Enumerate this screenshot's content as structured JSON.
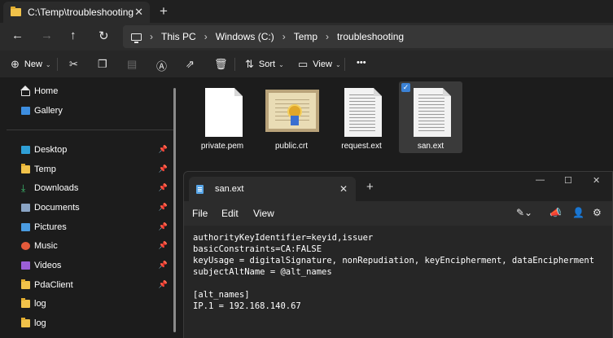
{
  "explorer": {
    "tab_title": "C:\\Temp\\troubleshooting",
    "tab_close": "✕",
    "new_tab": "+",
    "nav": {
      "back": "←",
      "forward": "→",
      "up": "↑",
      "refresh": "↻"
    },
    "breadcrumb": [
      "This PC",
      "Windows (C:)",
      "Temp",
      "troubleshooting"
    ],
    "breadcrumb_sep": "›",
    "commands": {
      "new": "New",
      "sort": "Sort",
      "view": "View",
      "more": "•••"
    },
    "sidebar": {
      "top_items": [
        {
          "label": "Home",
          "icon": "home-icon"
        },
        {
          "label": "Gallery",
          "icon": "gallery-icon"
        }
      ],
      "items": [
        {
          "label": "Desktop",
          "icon": "desktop-icon",
          "pinned": true
        },
        {
          "label": "Temp",
          "icon": "folder-icon",
          "pinned": true
        },
        {
          "label": "Downloads",
          "icon": "downloads-icon",
          "pinned": true
        },
        {
          "label": "Documents",
          "icon": "documents-icon",
          "pinned": true
        },
        {
          "label": "Pictures",
          "icon": "pictures-icon",
          "pinned": true
        },
        {
          "label": "Music",
          "icon": "music-icon",
          "pinned": true
        },
        {
          "label": "Videos",
          "icon": "videos-icon",
          "pinned": true
        },
        {
          "label": "PdaClient",
          "icon": "folder-icon",
          "pinned": true
        },
        {
          "label": "log",
          "icon": "folder-icon",
          "pinned": false
        },
        {
          "label": "log",
          "icon": "folder-icon",
          "pinned": false
        }
      ]
    },
    "files": [
      {
        "name": "private.pem",
        "icon": "blank-file-icon",
        "selected": false
      },
      {
        "name": "public.crt",
        "icon": "certificate-icon",
        "selected": false
      },
      {
        "name": "request.ext",
        "icon": "text-file-icon",
        "selected": false
      },
      {
        "name": "san.ext",
        "icon": "text-file-icon",
        "selected": true
      }
    ]
  },
  "notepad": {
    "tab_title": "san.ext",
    "tab_close": "✕",
    "new_tab": "+",
    "window_controls": {
      "minimize": "—",
      "maximize": "☐",
      "close": "✕"
    },
    "menu": {
      "file": "File",
      "edit": "Edit",
      "view": "View"
    },
    "content_lines": [
      "authorityKeyIdentifier=keyid,issuer",
      "basicConstraints=CA:FALSE",
      "keyUsage = digitalSignature, nonRepudiation, keyEncipherment, dataEncipherment",
      "subjectAltName = @alt_names",
      "",
      "[alt_names]",
      "IP.1 = 192.168.140.67"
    ]
  },
  "colors": {
    "background": "#1c1c1c",
    "accent": "#3b82d6",
    "folder": "#f1c24a"
  }
}
